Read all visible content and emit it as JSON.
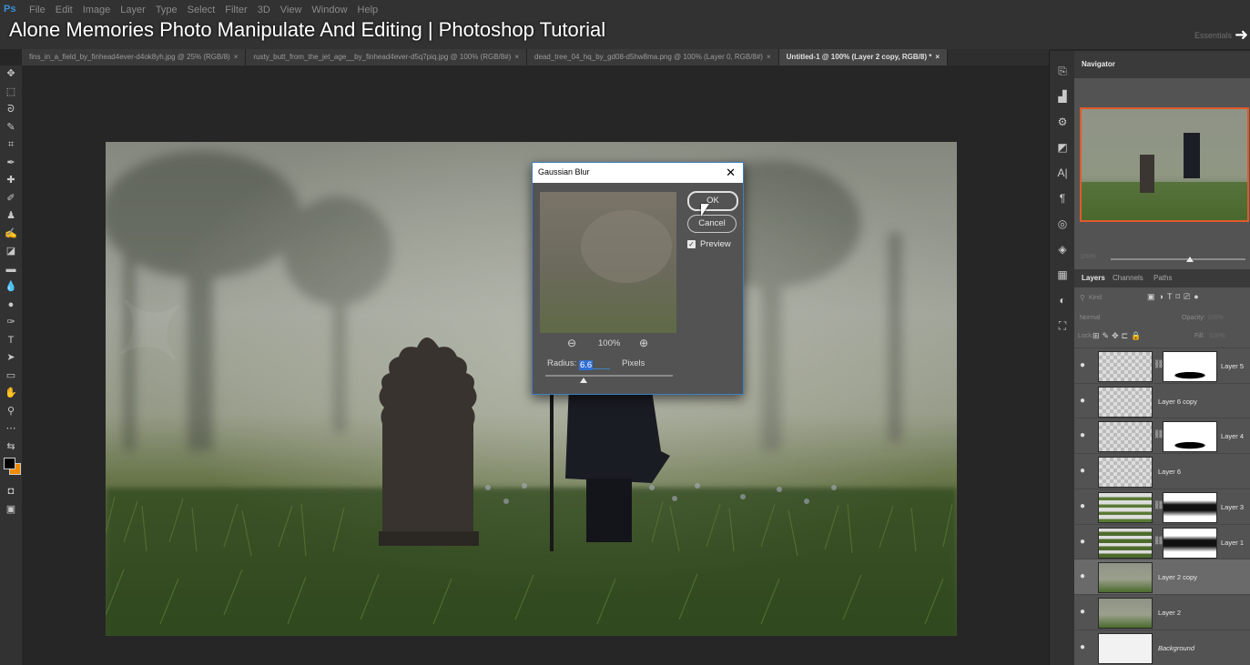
{
  "app": {
    "logo": "Ps"
  },
  "menu": [
    "File",
    "Edit",
    "Image",
    "Layer",
    "Type",
    "Select",
    "Filter",
    "3D",
    "View",
    "Window",
    "Help"
  ],
  "video_title": "Alone Memories Photo Manipulate And Editing | Photoshop Tutorial",
  "workspace": "Essentials",
  "tabs": [
    {
      "label": "fins_in_a_field_by_finhead4ever-d4ok8yh.jpg @ 25% (RGB/8)",
      "close": "×"
    },
    {
      "label": "rusty_butt_from_the_jet_age__by_finhead4ever-d5q7piq.jpg @ 100% (RGB/8#)",
      "close": "×"
    },
    {
      "label": "dead_tree_04_hq_by_gd08-d5hw8ma.png @ 100% (Layer 0, RGB/8#)",
      "close": "×"
    },
    {
      "label": "Untitled-1 @ 100% (Layer 2 copy, RGB/8) *",
      "close": "×"
    }
  ],
  "dialog": {
    "title": "Gaussian Blur",
    "close": "✕",
    "ok": "OK",
    "cancel": "Cancel",
    "preview_label": "Preview",
    "preview_checked": true,
    "zoom": "100%",
    "radius_label": "Radius:",
    "radius_value": "6.6",
    "radius_unit": "Pixels"
  },
  "panels": {
    "navigator_tab": "Navigator",
    "nav_zoom": "100%",
    "layer_tabs": [
      "Layers",
      "Channels",
      "Paths"
    ],
    "filter_kind": "Kind",
    "blend_mode": "Normal",
    "opacity_label": "Opacity:",
    "opacity_value": "100%",
    "lock_label": "Lock:",
    "fill_label": "Fill:",
    "fill_value": "100%"
  },
  "layers": [
    {
      "name": "Layer 5",
      "has_mask": true
    },
    {
      "name": "Layer 6 copy",
      "has_mask": false
    },
    {
      "name": "Layer 4",
      "has_mask": true
    },
    {
      "name": "Layer 6",
      "has_mask": false
    },
    {
      "name": "Layer 3",
      "has_mask": true
    },
    {
      "name": "Layer 1",
      "has_mask": true
    },
    {
      "name": "Layer 2 copy",
      "has_mask": false,
      "selected": true
    },
    {
      "name": "Layer 2",
      "has_mask": false
    },
    {
      "name": "Background",
      "has_mask": false,
      "italic": true
    }
  ],
  "colors": {
    "foreground": "#000000",
    "background": "#f08a00",
    "accent": "#3f7fc4"
  }
}
